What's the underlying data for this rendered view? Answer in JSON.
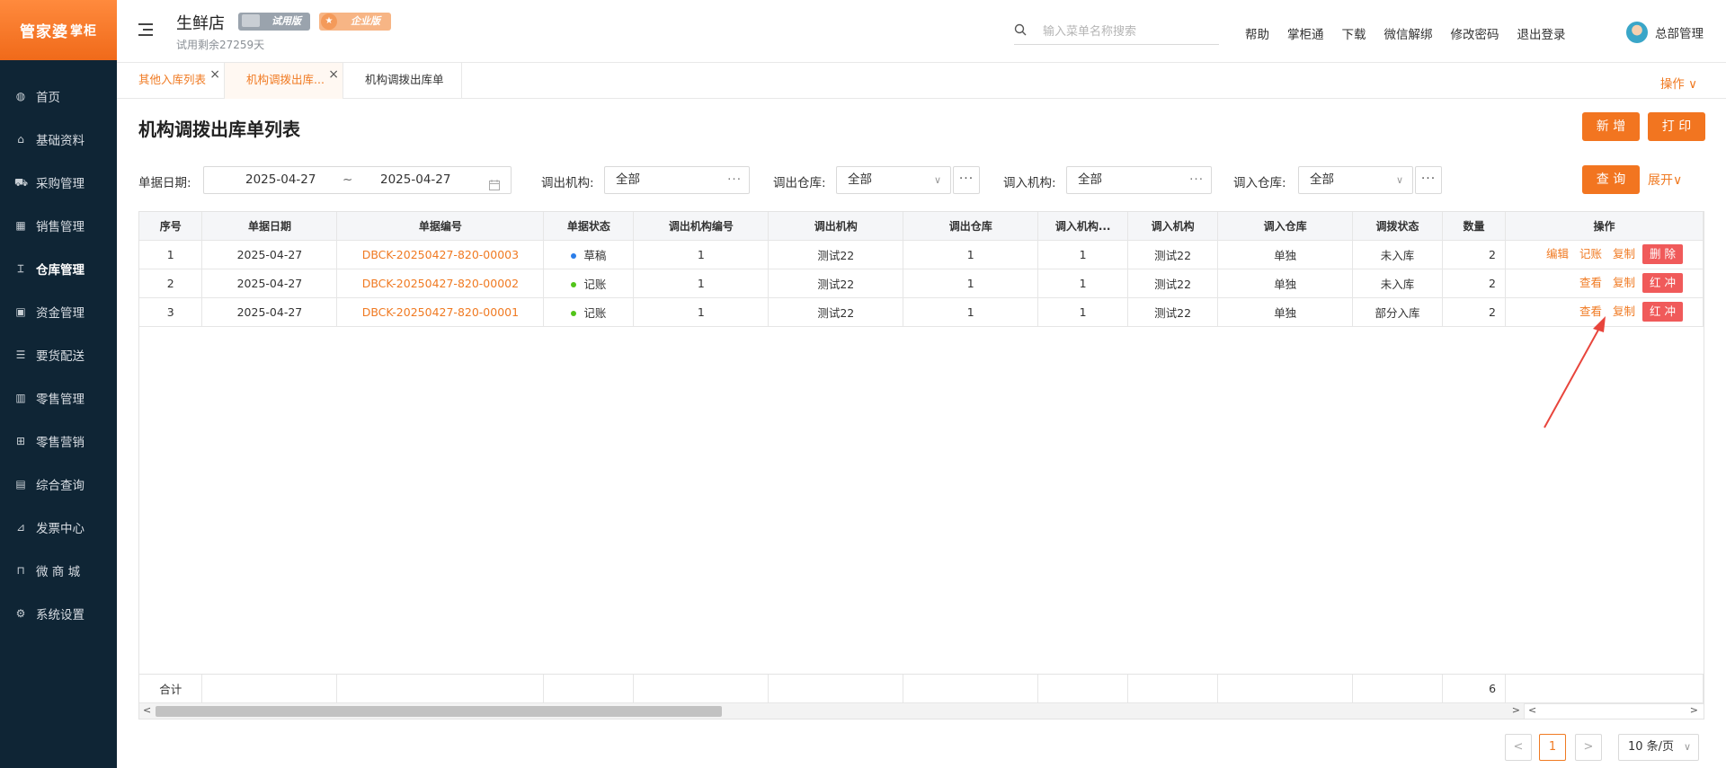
{
  "logo": {
    "main": "管家婆",
    "sub": "掌柜"
  },
  "sidebar": {
    "items": [
      {
        "label": "首页",
        "icon": "globe-icon"
      },
      {
        "label": "基础资料",
        "icon": "home-icon"
      },
      {
        "label": "采购管理",
        "icon": "cart-icon"
      },
      {
        "label": "销售管理",
        "icon": "calendar-icon"
      },
      {
        "label": "仓库管理",
        "icon": "bank-icon"
      },
      {
        "label": "资金管理",
        "icon": "money-icon"
      },
      {
        "label": "要货配送",
        "icon": "list-icon"
      },
      {
        "label": "零售管理",
        "icon": "bar-chart-icon"
      },
      {
        "label": "零售营销",
        "icon": "gift-icon"
      },
      {
        "label": "综合查询",
        "icon": "chart-icon"
      },
      {
        "label": "发票中心",
        "icon": "trend-icon"
      },
      {
        "label": "微 商 城",
        "icon": "bag-icon"
      },
      {
        "label": "系统设置",
        "icon": "gear-icon"
      }
    ],
    "active_index": 4
  },
  "header": {
    "store": "生鲜店",
    "badge_trial": "试用版",
    "badge_edition": "企业版",
    "trial_left": "试用剩余27259天",
    "search_placeholder": "输入菜单名称搜索",
    "links": [
      "帮助",
      "掌柜通",
      "下载",
      "微信解绑",
      "修改密码",
      "退出登录"
    ],
    "user": "总部管理"
  },
  "tabs": [
    {
      "label": "其他入库列表"
    },
    {
      "label": "机构调拨出库..."
    },
    {
      "label": "机构调拨出库单"
    }
  ],
  "tab_ops": "操作 ∨",
  "page": {
    "title": "机构调拨出库单列表",
    "add": "新 增",
    "print": "打 印",
    "query": "查 询",
    "expand": "展开∨"
  },
  "filters": {
    "date_label": "单据日期:",
    "date_from": "2025-04-27",
    "date_sep": "~",
    "date_to": "2025-04-27",
    "out_org_label": "调出机构:",
    "out_org": "全部",
    "out_wh_label": "调出仓库:",
    "out_wh": "全部",
    "in_org_label": "调入机构:",
    "in_org": "全部",
    "in_wh_label": "调入仓库:",
    "in_wh": "全部"
  },
  "table": {
    "columns": [
      "序号",
      "单据日期",
      "单据编号",
      "单据状态",
      "调出机构编号",
      "调出机构",
      "调出仓库",
      "调入机构...",
      "调入机构",
      "调入仓库",
      "调拨状态",
      "数量",
      "操作"
    ],
    "rows": [
      {
        "no": "1",
        "date": "2025-04-27",
        "code": "DBCK-20250427-820-00003",
        "status": "草稿",
        "status_color": "#2b7de9",
        "out_org_no": "1",
        "out_org": "测试22",
        "out_wh": "1",
        "in_org_no": "1",
        "in_org": "测试22",
        "in_wh": "单独",
        "transfer": "未入库",
        "qty": "2",
        "ops": [
          "编辑",
          "记账",
          "复制"
        ],
        "red": "删 除"
      },
      {
        "no": "2",
        "date": "2025-04-27",
        "code": "DBCK-20250427-820-00002",
        "status": "记账",
        "status_color": "#52c41a",
        "out_org_no": "1",
        "out_org": "测试22",
        "out_wh": "1",
        "in_org_no": "1",
        "in_org": "测试22",
        "in_wh": "单独",
        "transfer": "未入库",
        "qty": "2",
        "ops": [
          "查看",
          "复制"
        ],
        "red": "红 冲"
      },
      {
        "no": "3",
        "date": "2025-04-27",
        "code": "DBCK-20250427-820-00001",
        "status": "记账",
        "status_color": "#52c41a",
        "out_org_no": "1",
        "out_org": "测试22",
        "out_wh": "1",
        "in_org_no": "1",
        "in_org": "测试22",
        "in_wh": "单独",
        "transfer": "部分入库",
        "qty": "2",
        "ops": [
          "查看",
          "复制"
        ],
        "red": "红 冲"
      }
    ],
    "sum_label": "合计",
    "sum_qty": "6"
  },
  "pagination": {
    "current": "1",
    "prev": "<",
    "next": ">",
    "size": "10 条/页"
  },
  "colors": {
    "accent": "#f27520",
    "sidebar": "#0f2535",
    "danger": "#f05a5a"
  }
}
